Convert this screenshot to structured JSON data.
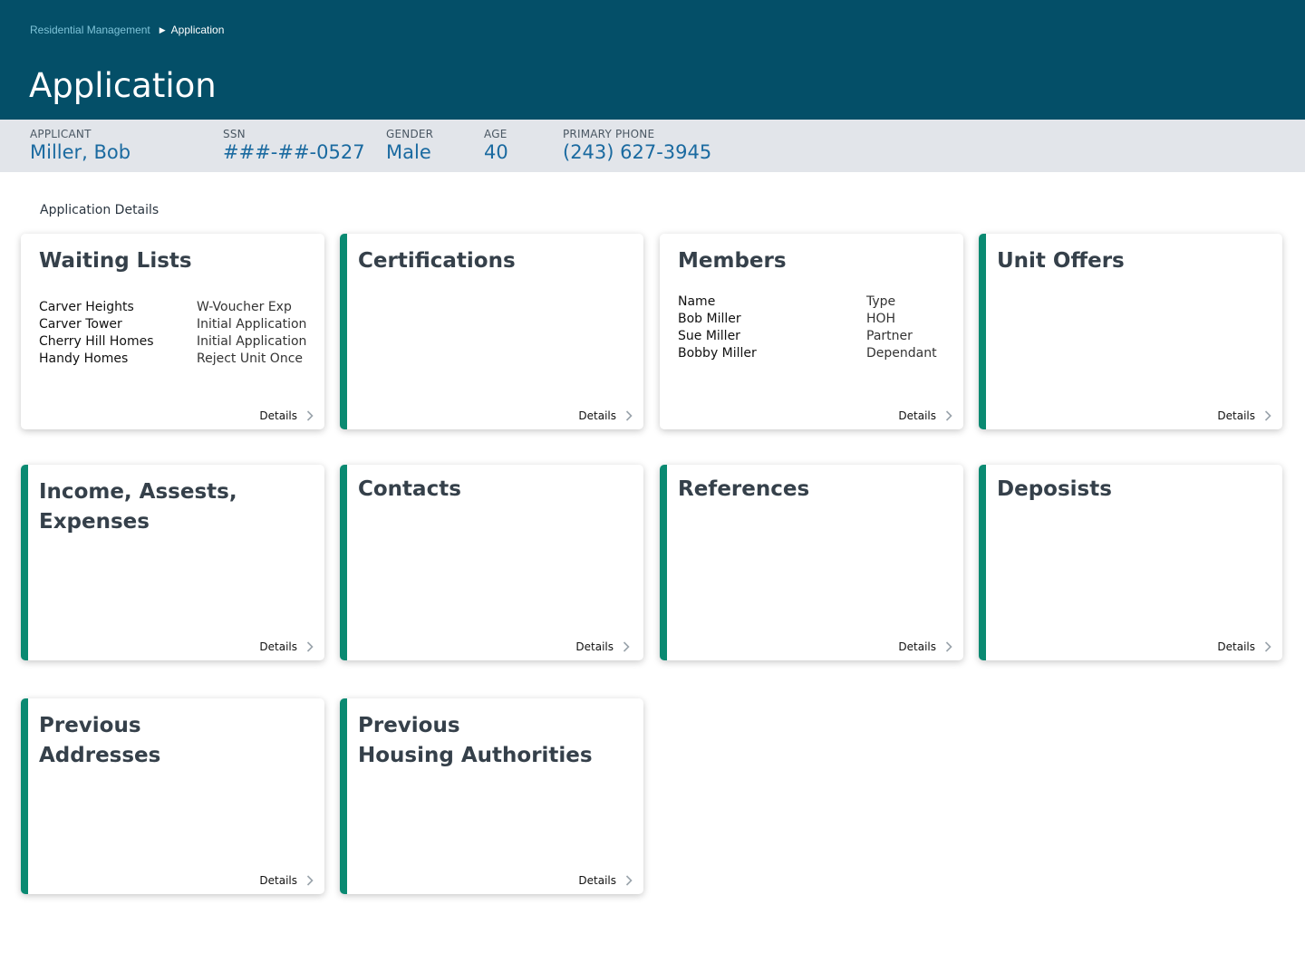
{
  "breadcrumb": {
    "parent": "Residential Management",
    "current": "Application"
  },
  "page_title": "Application",
  "applicant": {
    "applicant_label": "APPLICANT",
    "applicant_value": "Miller, Bob",
    "ssn_label": "SSN",
    "ssn_value": "###-##-0527",
    "gender_label": "GENDER",
    "gender_value": "Male",
    "age_label": "AGE",
    "age_value": "40",
    "phone_label": "PRIMARY PHONE",
    "phone_value": "(243) 627-3945"
  },
  "section_label": "Application Details",
  "details_label": "Details",
  "cards": {
    "waiting_lists": {
      "title": "Waiting Lists",
      "rows": [
        {
          "name": "Carver Heights",
          "type": "W-Voucher Exp"
        },
        {
          "name": "Carver Tower",
          "type": "Initial Application"
        },
        {
          "name": "Cherry Hill Homes",
          "type": "Initial Application"
        },
        {
          "name": "Handy Homes",
          "type": "Reject Unit Once"
        }
      ]
    },
    "certifications": {
      "title": "Certifications"
    },
    "members": {
      "title": "Members",
      "header": {
        "name": "Name",
        "type": "Type"
      },
      "rows": [
        {
          "name": "Bob Miller",
          "type": "HOH"
        },
        {
          "name": "Sue Miller",
          "type": "Partner"
        },
        {
          "name": "Bobby Miller",
          "type": "Dependant"
        }
      ]
    },
    "unit_offers": {
      "title": "Unit Offers"
    },
    "income": {
      "title_line1": "Income, Assests,",
      "title_line2": "Expenses"
    },
    "contacts": {
      "title": "Contacts"
    },
    "references": {
      "title": "References"
    },
    "deposits": {
      "title": "Deposists"
    },
    "previous_addresses": {
      "title_line1": "Previous",
      "title_line2": "Addresses"
    },
    "previous_housing": {
      "title_line1": "Previous",
      "title_line2": "Housing Authorities"
    }
  },
  "colors": {
    "header": "#044f68",
    "accent": "#0a8a72",
    "value_text": "#1a6aa0",
    "info_bar": "#e2e5ea"
  }
}
